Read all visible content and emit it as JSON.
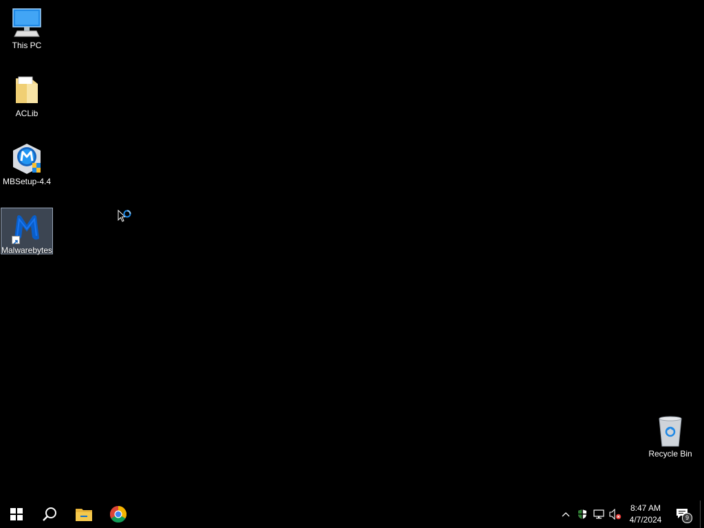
{
  "desktop": {
    "background_color": "#000000",
    "icons": [
      {
        "label": "This PC",
        "icon": "this-pc-icon",
        "selected": false
      },
      {
        "label": "ACLib",
        "icon": "folder-icon",
        "selected": false
      },
      {
        "label": "MBSetup-4.4",
        "icon": "installer-icon",
        "selected": false
      },
      {
        "label": "Malwarebytes",
        "icon": "malwarebytes-icon",
        "selected": true,
        "shortcut": true
      },
      {
        "label": "Recycle Bin",
        "icon": "recycle-bin-icon",
        "selected": false
      }
    ],
    "cursor": {
      "state": "busy",
      "icon": "busy-cursor-icon"
    }
  },
  "taskbar": {
    "background_color": "#000000",
    "pinned": [
      {
        "name": "Start",
        "icon": "windows-logo-icon"
      },
      {
        "name": "Search",
        "icon": "search-icon"
      },
      {
        "name": "File Explorer",
        "icon": "folder-icon"
      },
      {
        "name": "Google Chrome",
        "icon": "chrome-icon"
      }
    ],
    "tray": {
      "icons": [
        "chevron-up-icon",
        "security-shield-icon",
        "network-icon",
        "volume-muted-icon"
      ],
      "time": "8:47 AM",
      "date": "4/7/2024",
      "notification_count": "9"
    }
  },
  "colors": {
    "selection_bg": "#6d7e96",
    "accent_blue": "#0a5ec8",
    "text": "#ffffff"
  }
}
